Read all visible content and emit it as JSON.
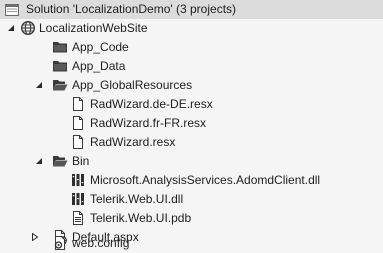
{
  "solution": {
    "label": "Solution 'LocalizationDemo' (3 projects)",
    "icon": "solution-icon"
  },
  "project": {
    "label": "LocalizationWebSite",
    "icon": "globe-icon",
    "state": "expanded"
  },
  "folders": {
    "app_code": {
      "label": "App_Code",
      "icon": "folder-icon"
    },
    "app_data": {
      "label": "App_Data",
      "icon": "folder-icon"
    },
    "app_globalresources": {
      "label": "App_GlobalResources",
      "icon": "folder-open-icon",
      "state": "expanded",
      "files": [
        {
          "label": "RadWizard.de-DE.resx",
          "icon": "resx-file-icon"
        },
        {
          "label": "RadWizard.fr-FR.resx",
          "icon": "resx-file-icon"
        },
        {
          "label": "RadWizard.resx",
          "icon": "resx-file-icon"
        }
      ]
    },
    "bin": {
      "label": "Bin",
      "icon": "folder-open-icon",
      "state": "expanded",
      "files": [
        {
          "label": "Microsoft.AnalysisServices.AdomdClient.dll",
          "icon": "dll-file-icon"
        },
        {
          "label": "Telerik.Web.UI.dll",
          "icon": "dll-file-icon"
        },
        {
          "label": "Telerik.Web.UI.pdb",
          "icon": "pdb-file-icon"
        }
      ]
    }
  },
  "items": {
    "default_aspx": {
      "label": "Default.aspx",
      "icon": "aspx-file-icon",
      "state": "collapsed"
    },
    "web_config": {
      "label": "web.config",
      "icon": "config-file-icon"
    }
  }
}
